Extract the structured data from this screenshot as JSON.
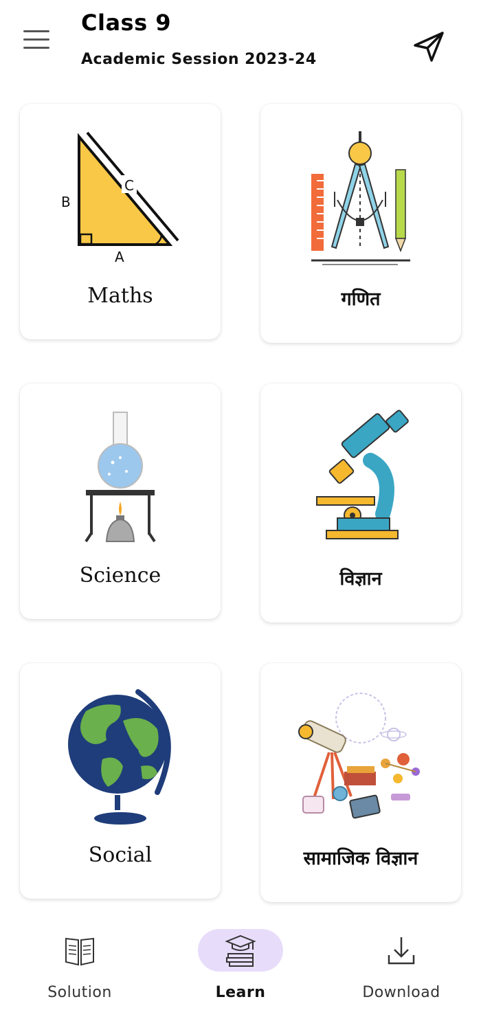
{
  "header": {
    "title": "Class 9",
    "subtitle": "Academic Session 2023-24",
    "menu_icon": "hamburger-menu-icon",
    "share_icon": "send-icon"
  },
  "subjects": [
    {
      "label": "Maths",
      "icon": "right-triangle-icon",
      "triangle_labels": [
        "B",
        "C",
        "A"
      ]
    },
    {
      "label": "गणित",
      "icon": "geometry-tools-icon"
    },
    {
      "label": "Science",
      "icon": "flask-burner-icon"
    },
    {
      "label": "विज्ञान",
      "icon": "microscope-icon"
    },
    {
      "label": "Social",
      "icon": "globe-icon"
    },
    {
      "label": "सामाजिक विज्ञान",
      "icon": "astronomy-tools-icon"
    }
  ],
  "bottom_nav": {
    "items": [
      {
        "label": "Solution",
        "icon": "open-book-icon",
        "active": false
      },
      {
        "label": "Learn",
        "icon": "graduation-books-icon",
        "active": true
      },
      {
        "label": "Download",
        "icon": "download-icon",
        "active": false
      }
    ],
    "active_color": "#e8dcfb"
  },
  "colors": {
    "triangle": "#f9c846",
    "ruler": "#f26b3a",
    "compass": "#8fd3e8",
    "pencil": "#b7d94a",
    "microscope_blue": "#3aa6c4",
    "microscope_yellow": "#f5b82e",
    "globe_land": "#6ab04c",
    "globe_ocean": "#1f3d7a"
  }
}
